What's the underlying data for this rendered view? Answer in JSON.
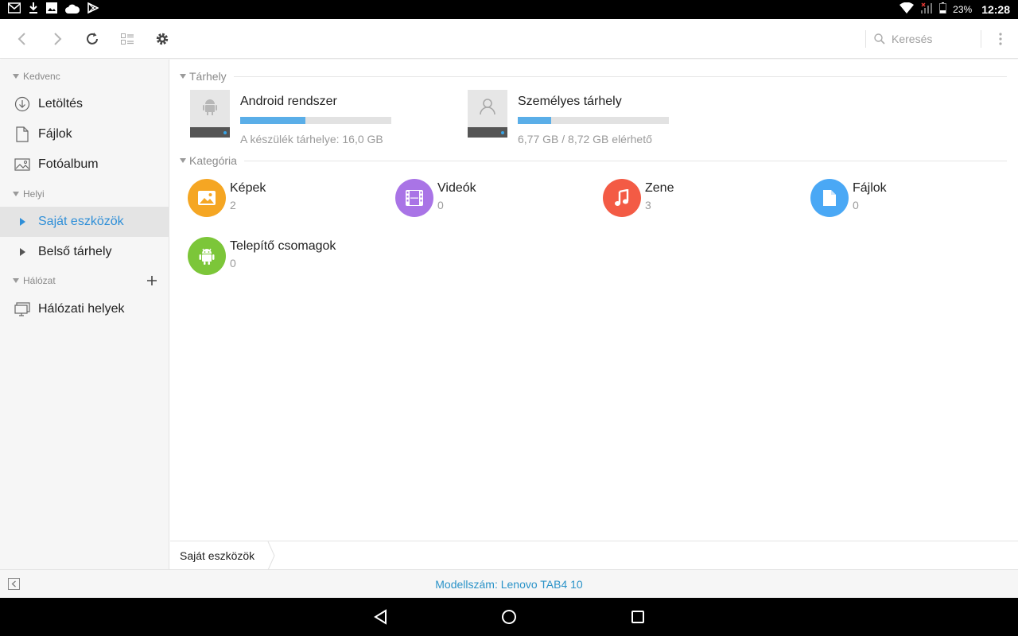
{
  "status_bar": {
    "battery": "23%",
    "time": "12:28",
    "left_icons": [
      "gmail-icon",
      "download-icon",
      "image-icon",
      "cloud-icon",
      "play-store-icon"
    ],
    "right_icons": [
      "wifi-icon",
      "signal-icon",
      "battery-icon"
    ]
  },
  "toolbar": {
    "search_placeholder": "Keresés",
    "buttons": [
      "back-icon",
      "forward-icon",
      "refresh-icon",
      "view-toggle-icon",
      "settings-icon",
      "more-icon"
    ]
  },
  "sidebar": {
    "sections": [
      {
        "label": "Kedvenc"
      },
      {
        "label": "Helyi"
      },
      {
        "label": "Hálózat"
      }
    ],
    "items": [
      {
        "label": "Letöltés",
        "icon": "download-circle-icon"
      },
      {
        "label": "Fájlok",
        "icon": "file-icon"
      },
      {
        "label": "Fotóalbum",
        "icon": "photo-icon"
      },
      {
        "label": "Saját eszközök",
        "icon": "triangle-right-icon"
      },
      {
        "label": "Belső tárhely",
        "icon": "triangle-right-icon"
      },
      {
        "label": "Hálózati helyek",
        "icon": "network-icon"
      }
    ]
  },
  "main": {
    "storage_heading": "Tárhely",
    "category_heading": "Kategória",
    "storage": [
      {
        "name": "Android rendszer",
        "detail": "A készülék tárhelye: 16,0 GB",
        "usage": 0.43,
        "icon": "android-icon"
      },
      {
        "name": "Személyes tárhely",
        "detail": "6,77 GB / 8,72 GB elérhető",
        "usage": 0.22,
        "icon": "person-icon"
      }
    ],
    "categories": [
      {
        "name": "Képek",
        "count": "2",
        "color": "#f5a623",
        "icon": "image-icon"
      },
      {
        "name": "Videók",
        "count": "0",
        "color": "#a974e6",
        "icon": "film-icon"
      },
      {
        "name": "Zene",
        "count": "3",
        "color": "#f35b45",
        "icon": "music-note-icon"
      },
      {
        "name": "Fájlok",
        "count": "0",
        "color": "#4aa8f5",
        "icon": "document-icon"
      },
      {
        "name": "Telepítő csomagok",
        "count": "0",
        "color": "#7cc639",
        "icon": "android-icon"
      }
    ]
  },
  "breadcrumb": {
    "current": "Saját eszközök"
  },
  "footer": {
    "model": "Modellszám: Lenovo TAB4 10"
  },
  "accent": "#2f8fd8"
}
